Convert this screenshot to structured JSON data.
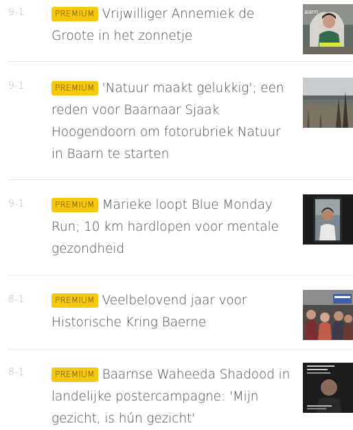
{
  "articles": [
    {
      "date": "9-1",
      "badge": "PREMIUM",
      "title": "Vrijwilliger Annemiek de Groote in het zonnetje",
      "thumb_text": "aarn"
    },
    {
      "date": "9-1",
      "badge": "PREMIUM",
      "title": "'Natuur maakt gelukkig'; een reden voor Baarnaar Sjaak Hoogendoorn om fotorubriek Natuur in Baarn te starten"
    },
    {
      "date": "9-1",
      "badge": "PREMIUM",
      "title": "Marieke loopt Blue Monday Run; 10 km hardlopen voor mentale gezondheid"
    },
    {
      "date": "8-1",
      "badge": "PREMIUM",
      "title": "Veelbelovend jaar voor Historische Kring Baerne"
    },
    {
      "date": "8-1",
      "badge": "PREMIUM",
      "title": "Baarnse Waheeda Shadood in landelijke postercampagne: 'Mijn gezicht, is hún gezicht'"
    }
  ],
  "colors": {
    "badge_bg": "#f6c90e",
    "title_text": "#4a4a4a",
    "date_text": "#b6b6b6",
    "divider": "#e6e6e6"
  }
}
